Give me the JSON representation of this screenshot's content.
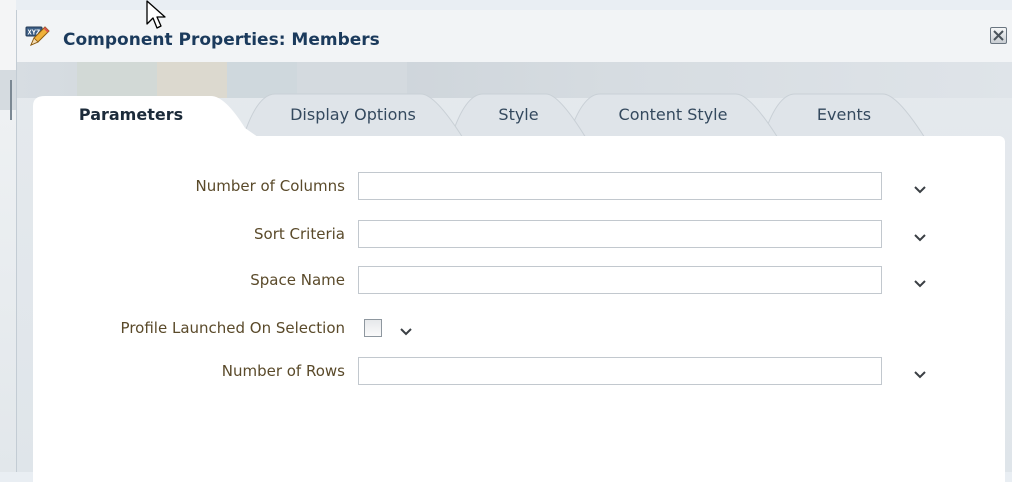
{
  "dialog": {
    "title": "Component Properties: Members",
    "title_icon": "xyz-edit-icon",
    "close_icon": "close-icon"
  },
  "tabs": [
    {
      "label": "Parameters",
      "active": true
    },
    {
      "label": "Display Options",
      "active": false
    },
    {
      "label": "Style",
      "active": false
    },
    {
      "label": "Content Style",
      "active": false
    },
    {
      "label": "Events",
      "active": false
    }
  ],
  "fields": {
    "number_of_columns": {
      "label": "Number of Columns",
      "value": ""
    },
    "sort_criteria": {
      "label": "Sort Criteria",
      "value": ""
    },
    "space_name": {
      "label": "Space Name",
      "value": ""
    },
    "profile_launched": {
      "label": "Profile Launched On Selection",
      "checked": false
    },
    "number_of_rows": {
      "label": "Number of Rows",
      "value": ""
    }
  },
  "colors": {
    "title_text": "#1b3a5c",
    "label_text": "#5a4a2a",
    "panel_bg": "#ffffff",
    "chevron": "#3a3f44"
  }
}
